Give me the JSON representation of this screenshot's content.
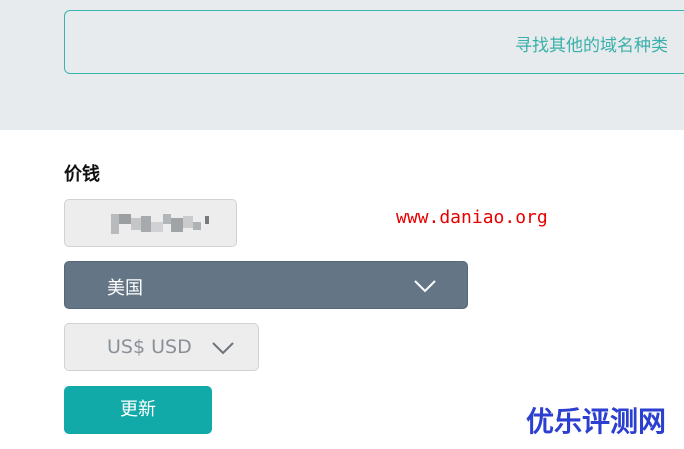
{
  "search": {
    "prompt_text": "寻找其他的域名种类"
  },
  "price": {
    "label": "价钱"
  },
  "watermark": {
    "url": "www.daniao.org",
    "logo": "优乐评测网"
  },
  "country_select": {
    "selected": "美国",
    "icon": "chevron-down-icon"
  },
  "currency_select": {
    "selected": "US$ USD",
    "icon": "chevron-down-icon"
  },
  "actions": {
    "update_label": "更新"
  },
  "colors": {
    "accent": "#11aaa8",
    "search_border": "#3bb3ad",
    "select_dark": "#647585",
    "watermark_red": "#e60000",
    "watermark_blue": "#2b3fd0"
  }
}
